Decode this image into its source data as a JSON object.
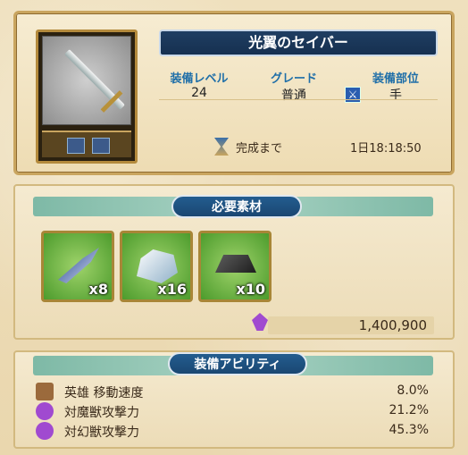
{
  "item": {
    "name": "光翼のセイバー",
    "level_label": "装備レベル",
    "level": "24",
    "grade_label": "グレード",
    "grade": "普通",
    "slot_label": "装備部位",
    "slot": "手",
    "timer_label": "完成まで",
    "timer": "1日18:18:50"
  },
  "materials": {
    "header": "必要素材",
    "items": [
      {
        "icon": "feather-icon",
        "count": "x8"
      },
      {
        "icon": "ice-stone-icon",
        "count": "x16"
      },
      {
        "icon": "iron-ingot-icon",
        "count": "x10"
      }
    ],
    "cost": "1,400,900"
  },
  "abilities": {
    "header": "装備アビリティ",
    "rows": [
      {
        "icon": "boot-icon",
        "label": "英雄 移動速度",
        "value": "8.0%"
      },
      {
        "icon": "demon-icon",
        "label": "対魔獣攻撃力",
        "value": "21.2%"
      },
      {
        "icon": "demon-icon",
        "label": "対幻獣攻撃力",
        "value": "45.3%"
      }
    ]
  }
}
